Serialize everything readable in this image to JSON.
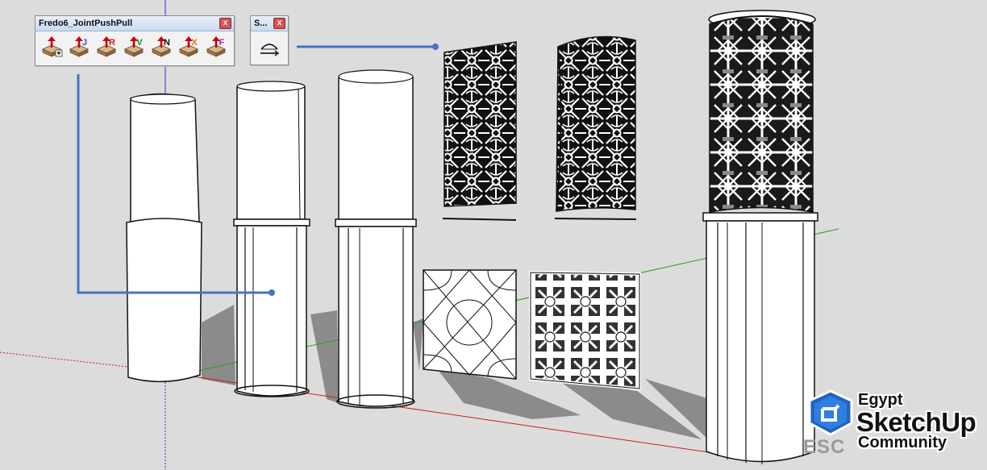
{
  "toolbar_joint": {
    "title": "Fredo6_JointPushPull",
    "close_glyph": "x",
    "buttons": [
      {
        "name": "push-pull-menu",
        "label": "",
        "color": "#cc0000",
        "has_dropdown": true
      },
      {
        "name": "joint-push-pull",
        "label": "J",
        "color": "#1f5fd6"
      },
      {
        "name": "round-push-pull",
        "label": "R",
        "color": "#d41c1c"
      },
      {
        "name": "vector-push-pull",
        "label": "V",
        "color": "#1e8f1e"
      },
      {
        "name": "normal-push-pull",
        "label": "N",
        "color": "#111111"
      },
      {
        "name": "extrude-push-pull",
        "label": "X",
        "color": "#e07a00"
      },
      {
        "name": "follow-push-pull",
        "label": "F",
        "color": "#b21fb2"
      }
    ]
  },
  "toolbar_small": {
    "title": "S...",
    "close_glyph": "x",
    "button_icon": "curved-surface-icon"
  },
  "logo": {
    "line1": "Egypt",
    "line2": "SketchUp",
    "line3": "Community",
    "prefix": "ESC"
  },
  "colors": {
    "background": "#dcdcdc",
    "callout_line": "#4a72c4",
    "axis_red": "#c81e1e",
    "axis_green": "#23a023",
    "axis_blue": "#3030c8",
    "shadow": "#7a7a7a"
  }
}
